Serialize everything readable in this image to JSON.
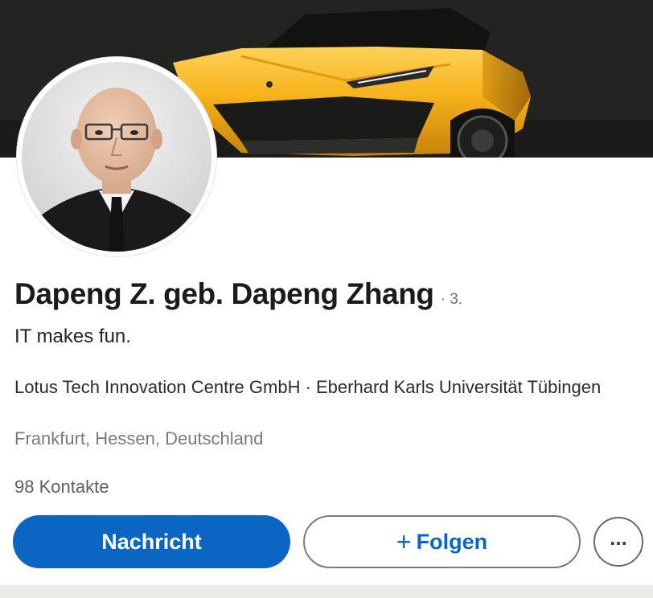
{
  "profile": {
    "name": "Dapeng Z. geb. Dapeng Zhang",
    "degree": "· 3.",
    "headline": "IT makes fun.",
    "company_line": "Lotus Tech Innovation Centre GmbH · Eberhard Karls Universität Tübingen",
    "location": "Frankfurt, Hessen, Deutschland",
    "connections": "98 Kontakte"
  },
  "actions": {
    "message_label": "Nachricht",
    "follow_plus": "+",
    "follow_label": "Folgen",
    "more_label": "..."
  },
  "colors": {
    "primary_blue": "#0a66c2",
    "cover_car_yellow": "#f5b21a"
  },
  "icons": {
    "more": "ellipsis-icon",
    "follow": "plus-icon"
  }
}
